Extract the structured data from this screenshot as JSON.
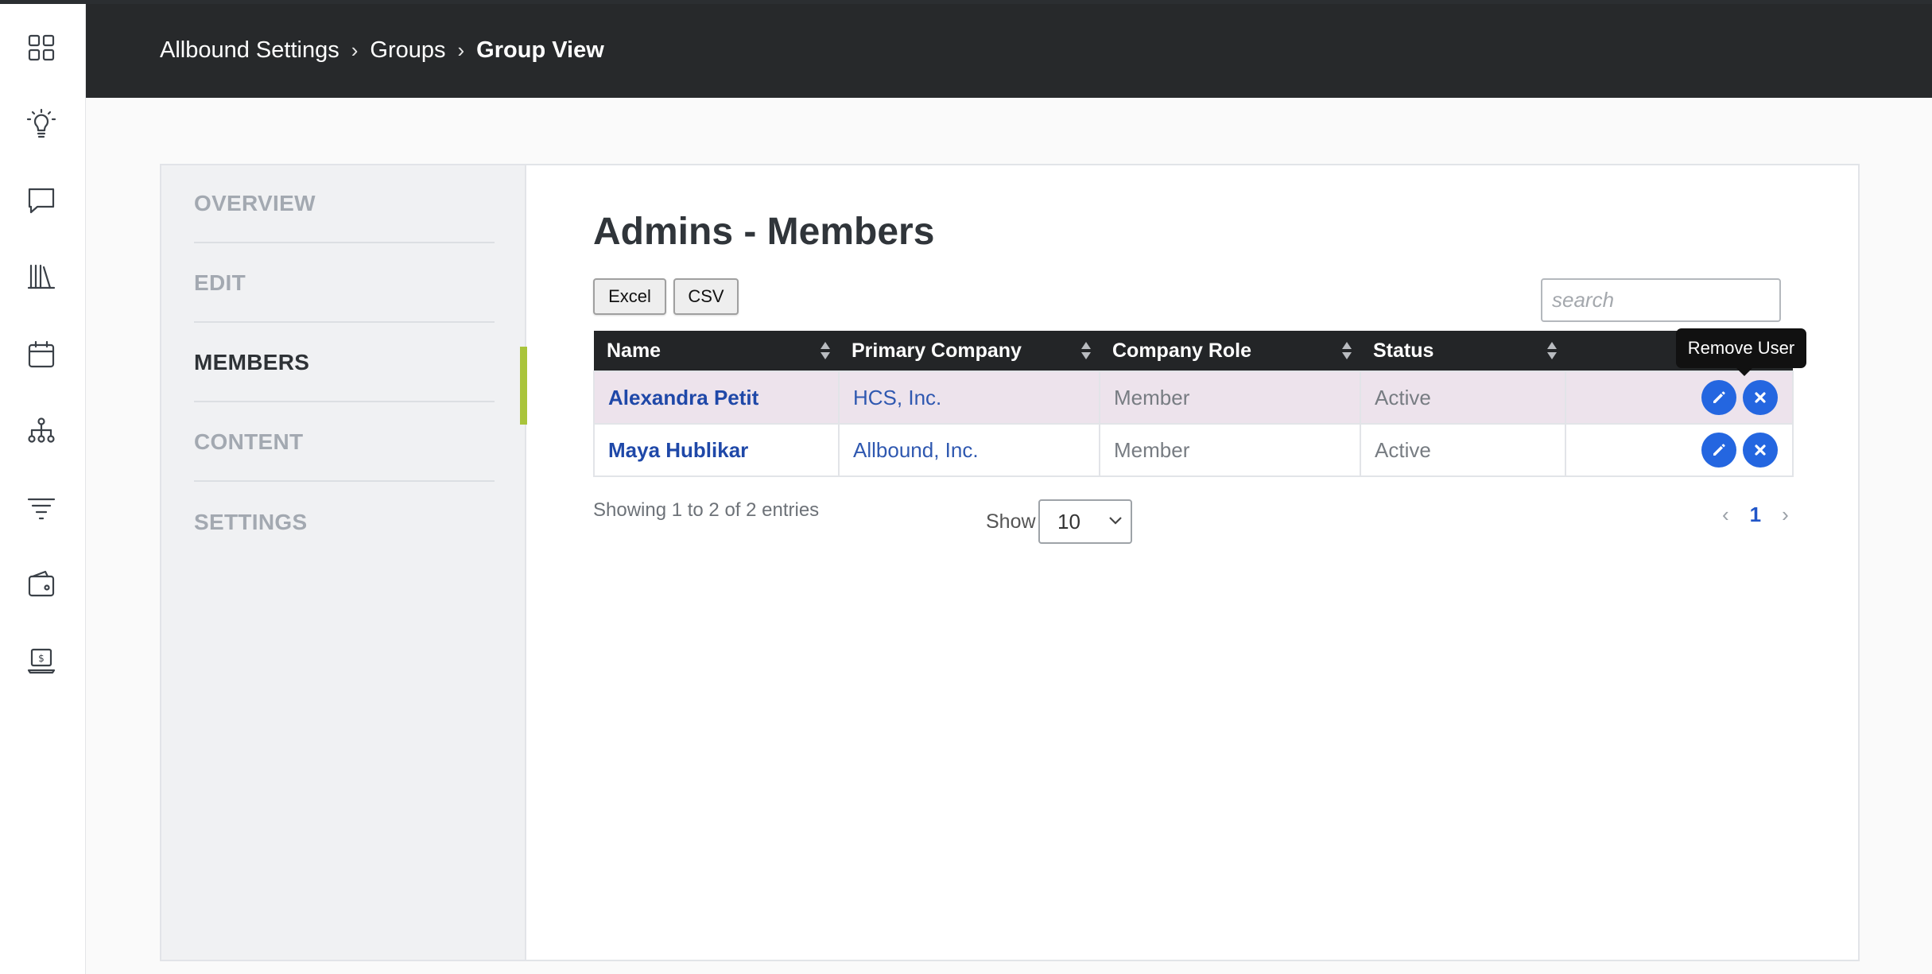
{
  "breadcrumb": {
    "root": "Allbound Settings",
    "groups": "Groups",
    "current": "Group View",
    "separator": "›"
  },
  "rail_icons": [
    "dashboard-icon",
    "lightbulb-icon",
    "chat-icon",
    "library-icon",
    "calendar-icon",
    "org-chart-icon",
    "filter-icon",
    "wallet-icon",
    "laptop-dollar-icon"
  ],
  "sidenav": {
    "items": [
      {
        "label": "OVERVIEW",
        "active": false
      },
      {
        "label": "EDIT",
        "active": false
      },
      {
        "label": "MEMBERS",
        "active": true
      },
      {
        "label": "CONTENT",
        "active": false
      },
      {
        "label": "SETTINGS",
        "active": false
      }
    ]
  },
  "main": {
    "title": "Admins - Members",
    "export_excel": "Excel",
    "export_csv": "CSV",
    "search_placeholder": "search",
    "columns": [
      "Name",
      "Primary Company",
      "Company Role",
      "Status",
      ""
    ],
    "rows": [
      {
        "name": "Alexandra Petit",
        "company": "HCS, Inc.",
        "role": "Member",
        "status": "Active",
        "highlighted": true
      },
      {
        "name": "Maya Hublikar",
        "company": "Allbound, Inc.",
        "role": "Member",
        "status": "Active",
        "highlighted": false
      }
    ],
    "tooltip": "Remove User",
    "info": "Showing 1 to 2 of 2 entries",
    "show_label": "Show",
    "page_size": "10",
    "pagination": {
      "prev": "‹",
      "current": "1",
      "next": "›"
    }
  },
  "colors": {
    "header": "#27292b",
    "accent_active": "#a9c43b",
    "link": "#1f48a8",
    "action_button": "#2466e0",
    "row_highlight": "#ede3ec"
  }
}
